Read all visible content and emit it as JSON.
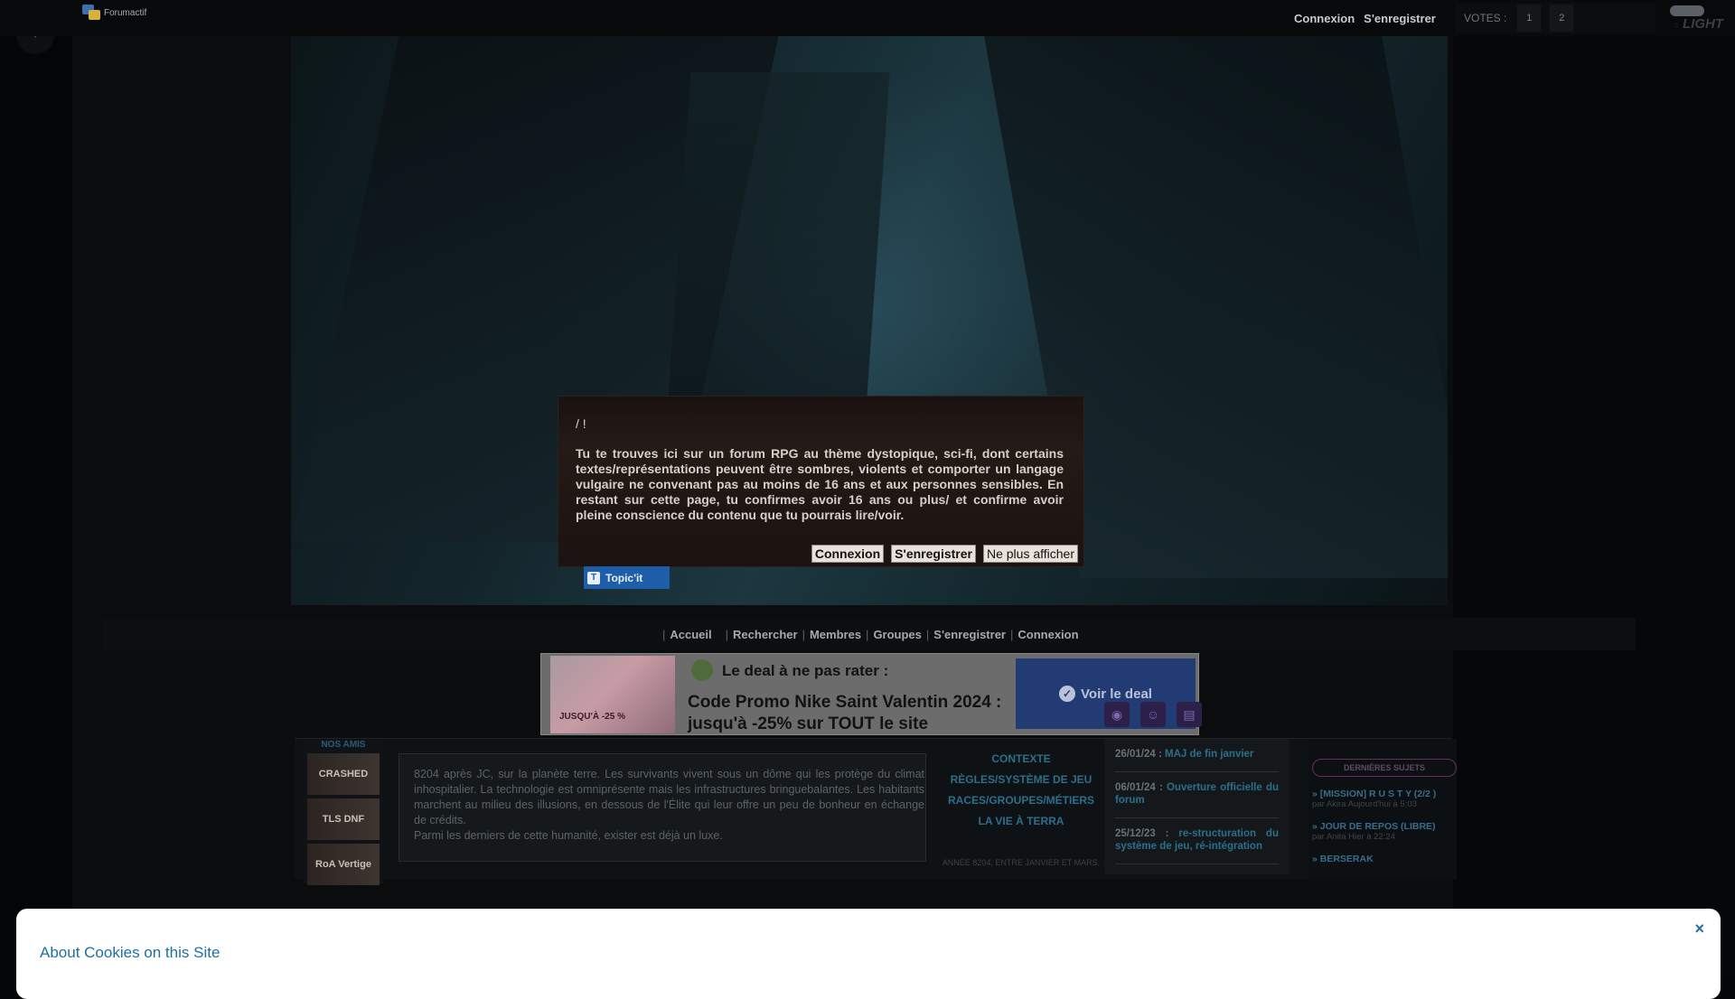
{
  "topbar": {
    "forum_brand": "Forumactif",
    "links": [
      "Connexion",
      "S'enregistrer"
    ],
    "votes_label": "VOTES :",
    "votes": [
      "1",
      "2"
    ],
    "theme_label": "LIGHT"
  },
  "sidebar": {
    "plus": "+"
  },
  "warning": {
    "title": "/ !",
    "text": "Tu te trouves ici sur un forum RPG au thème dystopique, sci-fi, dont certains textes/représentations peuvent être sombres, violents et comporter un langage vulgaire ne convenant pas au moins de 16 ans et aux personnes sensibles. En restant sur cette page, tu confirmes avoir 16 ans ou plus/ et confirme avoir pleine conscience du contenu que tu pourrais lire/voir.",
    "buttons": [
      "Connexion",
      "S'enregistrer",
      "Ne plus afficher"
    ]
  },
  "topicit": {
    "label": "Topic'it"
  },
  "nav": {
    "items": [
      "Accueil",
      "Rechercher",
      "Membres",
      "Groupes",
      "S'enregistrer",
      "Connexion"
    ]
  },
  "deal": {
    "image_label": "JUSQU'À -25 %",
    "heading": "Le deal à ne pas rater :",
    "title": "Code Promo Nike Saint Valentin 2024 : jusqu'à -25% sur TOUT le site",
    "cta": "Voir le deal"
  },
  "friends": {
    "title": "NOS AMIS",
    "items": [
      "CRASHED",
      "TLS DNF",
      "RoA Vertige"
    ]
  },
  "context": {
    "text": "8204 après JC, sur la planète terre. Les survivants vivent sous un dôme qui les protège du climat inhospitalier. La technologie est omniprésente mais les infrastructures bringuebalantes. Les habitants marchent au milieu des illusions, en dessous de l'Élite qui leur offre un peu de bonheur en échange de crédits.",
    "text2": "Parmi les derniers de cette humanité, exister est déjà un luxe."
  },
  "menu": {
    "items": [
      "CONTEXTE",
      "RÈGLES/SYSTÈME DE JEU",
      "RACES/GROUPES/MÉTIERS",
      "LA VIE À TERRA"
    ],
    "footer": "ANNÉE 8204, ENTRE JANVIER ET MARS."
  },
  "news": [
    {
      "date": "26/01/24 :",
      "text": "MAJ de fin janvier"
    },
    {
      "date": "06/01/24 :",
      "text": "Ouverture officielle du forum"
    },
    {
      "date": "25/12/23 :",
      "text": "re-structuration du système de jeu, ré-intégration"
    }
  ],
  "latest": {
    "title": "DERNIÈRES SUJETS",
    "items": [
      {
        "topic": "» [MISSION] R U S T Y (2/2 )",
        "meta": "par Akira Aujourd'hui à 5:03"
      },
      {
        "topic": "» JOUR DE REPOS (LIBRE)",
        "meta": "par Anita Hier à 22:24"
      },
      {
        "topic": "» BERSERAK",
        "meta": ""
      }
    ]
  },
  "cookie": {
    "title": "About Cookies on this Site",
    "close": "×",
    "text": ""
  }
}
